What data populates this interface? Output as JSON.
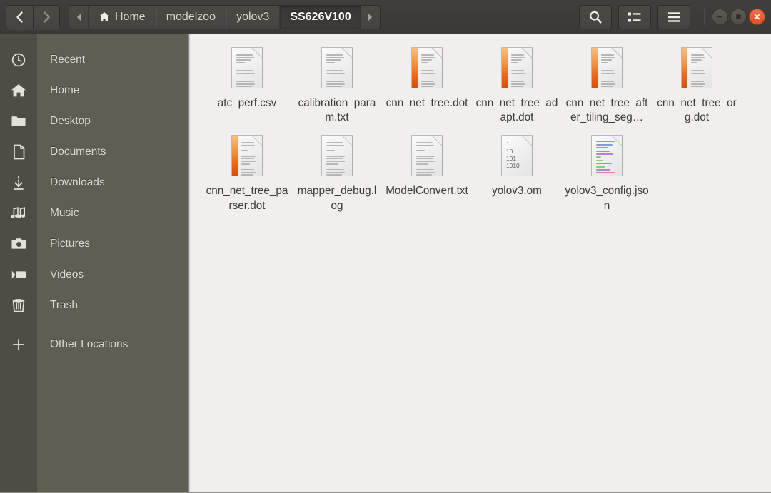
{
  "header": {
    "nav": {
      "back_label": "Back",
      "forward_label": "Forward"
    },
    "path_scroll_left": "scroll-path-left",
    "path_scroll_right": "scroll-path-right",
    "breadcrumbs": [
      {
        "label": "Home",
        "icon": "home-icon",
        "active": false
      },
      {
        "label": "modelzoo",
        "icon": "",
        "active": false
      },
      {
        "label": "yolov3",
        "icon": "",
        "active": false
      },
      {
        "label": "SS626V100",
        "icon": "",
        "active": true
      }
    ],
    "tools": [
      {
        "name": "search-button",
        "icon": "search-icon"
      },
      {
        "name": "view-toggle-button",
        "icon": "list-view-icon"
      },
      {
        "name": "menu-button",
        "icon": "hamburger-menu-icon"
      }
    ],
    "window_controls": [
      {
        "name": "minimize-button",
        "icon": "minimize-icon"
      },
      {
        "name": "maximize-button",
        "icon": "maximize-icon"
      },
      {
        "name": "close-button",
        "icon": "close-icon"
      }
    ]
  },
  "colors": {
    "headerbar": "#3f3d39",
    "icon_strip": "#4e4d45",
    "sidebar": "#605e52",
    "content": "#f0efee",
    "close_button": "#de4f25",
    "dot_file_accent": "#ed6512",
    "sidebar_text": "#dedcd7",
    "file_label_text": "#3a3a38"
  },
  "sidebar": {
    "items": [
      {
        "label": "Recent",
        "icon": "clock-icon"
      },
      {
        "label": "Home",
        "icon": "home-icon"
      },
      {
        "label": "Desktop",
        "icon": "folder-icon"
      },
      {
        "label": "Documents",
        "icon": "document-icon"
      },
      {
        "label": "Downloads",
        "icon": "download-icon"
      },
      {
        "label": "Music",
        "icon": "music-note-icon"
      },
      {
        "label": "Pictures",
        "icon": "camera-icon"
      },
      {
        "label": "Videos",
        "icon": "video-camera-icon"
      },
      {
        "label": "Trash",
        "icon": "trash-icon"
      },
      {
        "label": "Other Locations",
        "icon": "plus-icon"
      }
    ]
  },
  "files": [
    {
      "name": "atc_perf.csv",
      "icon": "document-icon",
      "type": "plain"
    },
    {
      "name": "calibration_param.txt",
      "icon": "document-icon",
      "type": "plain"
    },
    {
      "name": "cnn_net_tree.dot",
      "icon": "document-icon",
      "type": "striped"
    },
    {
      "name": "cnn_net_tree_adapt.dot",
      "icon": "document-icon",
      "type": "striped"
    },
    {
      "name": "cnn_net_tree_after_tiling_seg…",
      "icon": "document-icon",
      "type": "striped"
    },
    {
      "name": "cnn_net_tree_org.dot",
      "icon": "document-icon",
      "type": "striped"
    },
    {
      "name": "cnn_net_tree_parser.dot",
      "icon": "document-icon",
      "type": "striped"
    },
    {
      "name": "mapper_debug.log",
      "icon": "document-icon",
      "type": "plain"
    },
    {
      "name": "ModelConvert.txt",
      "icon": "document-icon",
      "type": "plain"
    },
    {
      "name": "yolov3.om",
      "icon": "binary-file-icon",
      "type": "binary",
      "binary_lines": [
        "1",
        "10",
        "101",
        "1010"
      ]
    },
    {
      "name": "yolov3_config.json",
      "icon": "code-file-icon",
      "type": "code"
    }
  ]
}
